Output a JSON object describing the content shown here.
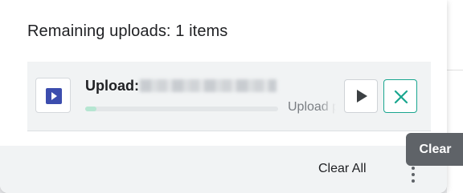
{
  "panel": {
    "title": "Remaining uploads: 1 items"
  },
  "upload_item": {
    "label": "Upload:",
    "status": "Upload p",
    "progress_fraction": 0.06,
    "icon": "video-file-icon"
  },
  "actions": {
    "resume_icon": "play-icon",
    "cancel_icon": "close-icon"
  },
  "footer": {
    "clear_all_label": "Clear All",
    "more_icon": "more-vertical-icon"
  },
  "tooltip": {
    "text": "Clear"
  },
  "colors": {
    "accent": "#1aa68f",
    "file_icon": "#3c4dae",
    "progress": "#b6e6d2",
    "tooltip_bg": "#5f6368"
  }
}
